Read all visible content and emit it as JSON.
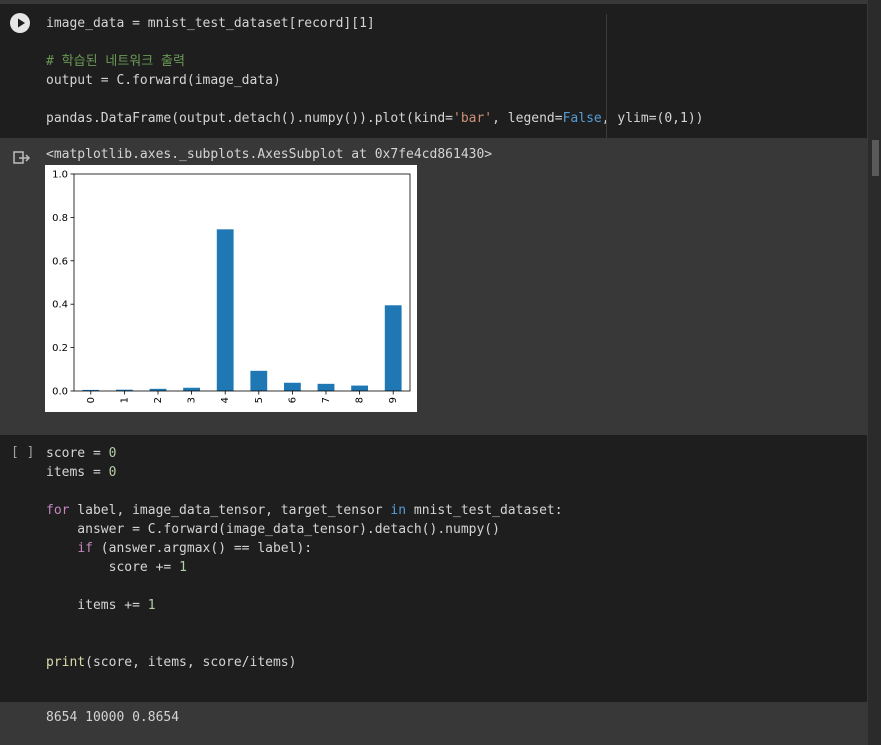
{
  "cell1": {
    "line1": "image_data = mnist_test_dataset[record][1]",
    "comment": "# 학습된 네트워크 출력",
    "line3": "output = C.forward(image_data)",
    "line5_pre": "pandas.DataFrame(output.detach().numpy()).plot(kind=",
    "line5_str": "'bar'",
    "line5_mid": ", legend=",
    "line5_kw": "False",
    "line5_post": ", ylim=(0,1))"
  },
  "output1": {
    "repr": "<matplotlib.axes._subplots.AxesSubplot at 0x7fe4cd861430>"
  },
  "chart_data": {
    "type": "bar",
    "categories": [
      "0",
      "1",
      "2",
      "3",
      "4",
      "5",
      "6",
      "7",
      "8",
      "9"
    ],
    "values": [
      0.005,
      0.006,
      0.01,
      0.015,
      0.745,
      0.093,
      0.038,
      0.033,
      0.025,
      0.395
    ],
    "ylim": [
      0,
      1
    ],
    "yticks": [
      "0.0",
      "0.2",
      "0.4",
      "0.6",
      "0.8",
      "1.0"
    ],
    "legend": false,
    "bar_color": "#1f77b4"
  },
  "cell2": {
    "brackets": "[ ]",
    "l1": "score = ",
    "l1_num": "0",
    "l2": "items = ",
    "l2_num": "0",
    "l4_kw1": "for",
    "l4_a": " label, image_data_tensor, target_tensor ",
    "l4_kw2": "in",
    "l4_b": " mnist_test_dataset:",
    "l5": "    answer = C.forward(image_data_tensor).detach().numpy()",
    "l6_kw": "if",
    "l6": " (answer.argmax() == label):",
    "l7": "        score += ",
    "l7_num": "1",
    "l9": "    items += ",
    "l9_num": "1",
    "l12_fn": "print",
    "l12": "(score, items, score/items)"
  },
  "output2": {
    "text": "8654 10000 0.8654"
  }
}
